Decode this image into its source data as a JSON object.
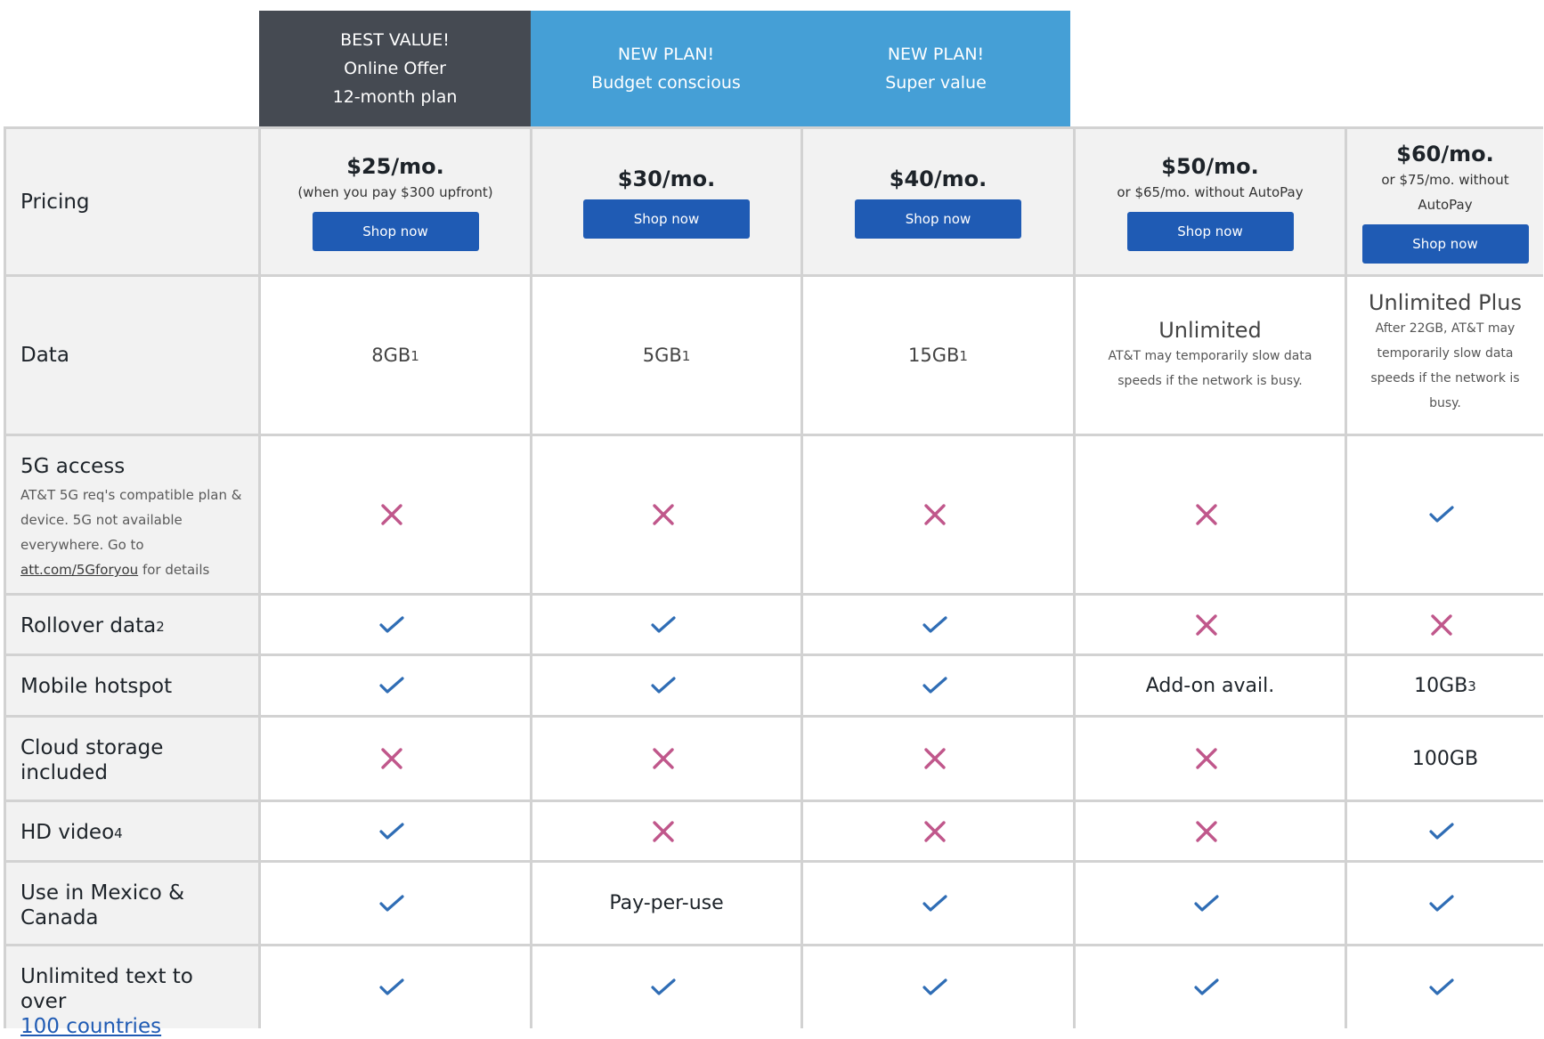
{
  "headers": [
    {
      "col": 1,
      "lines": [
        "BEST VALUE!",
        "Online Offer",
        "12-month plan"
      ],
      "style": "dark"
    },
    {
      "col": 2,
      "lines": [
        "NEW PLAN!",
        "Budget conscious"
      ],
      "style": "blue"
    },
    {
      "col": 3,
      "lines": [
        "NEW PLAN!",
        "Super value"
      ],
      "style": "blue"
    }
  ],
  "colors": {
    "check": "#2f6db5",
    "cross": "#c0578b",
    "button": "#1f5bb4",
    "header_dark": "#454a52",
    "header_blue": "#459fd6"
  },
  "rows": [
    {
      "label": "Pricing"
    },
    {
      "label": "Data"
    },
    {
      "label": "5G access",
      "note_text": "AT&T 5G req's compatible plan & device. 5G not available everywhere. Go to",
      "note_link": "att.com/5Gforyou",
      "note_after": "for details"
    },
    {
      "label": "Rollover data",
      "footnote": "2"
    },
    {
      "label": "Mobile hotspot"
    },
    {
      "label": "Cloud storage included"
    },
    {
      "label": "HD video",
      "footnote": "4"
    },
    {
      "label": "Use in Mexico & Canada"
    },
    {
      "label": "Unlimited text to over",
      "link": "100 countries"
    }
  ],
  "plans": [
    {
      "price": "$25/mo.",
      "price_note": "(when you pay $300 upfront)",
      "button": "Shop now",
      "data": {
        "value": "8GB",
        "footnote": "1"
      },
      "features": [
        "cross",
        "check",
        "check",
        "cross",
        "check",
        "check",
        "check"
      ]
    },
    {
      "price": "$30/mo.",
      "price_note": "",
      "button": "Shop now",
      "data": {
        "value": "5GB",
        "footnote": "1"
      },
      "features": [
        "cross",
        "check",
        "check",
        "cross",
        "cross",
        "Pay-per-use",
        "check"
      ]
    },
    {
      "price": "$40/mo.",
      "price_note": "",
      "button": "Shop now",
      "data": {
        "value": "15GB",
        "footnote": "1"
      },
      "features": [
        "cross",
        "check",
        "check",
        "cross",
        "cross",
        "check",
        "check"
      ]
    },
    {
      "price": "$50/mo.",
      "price_note": "or $65/mo. without AutoPay",
      "button": "Shop now",
      "data": {
        "title": "Unlimited",
        "note": "AT&T may temporarily slow data speeds if the network is busy."
      },
      "features": [
        "cross",
        "cross",
        "Add-on avail.",
        "cross",
        "cross",
        "check",
        "check"
      ]
    },
    {
      "price": "$60/mo.",
      "price_note": "or $75/mo. without AutoPay",
      "button": "Shop now",
      "data": {
        "title": "Unlimited Plus",
        "note": "After 22GB, AT&T may temporarily slow data speeds if the network is busy."
      },
      "features": [
        "check",
        "cross",
        {
          "value": "10GB",
          "footnote": "3"
        },
        "100GB",
        "check",
        "check",
        "check"
      ]
    }
  ]
}
